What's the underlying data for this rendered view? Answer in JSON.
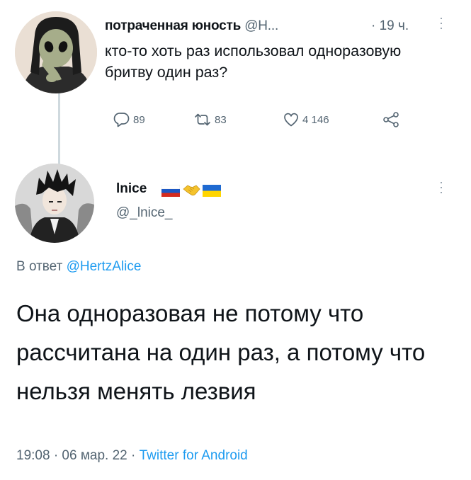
{
  "replied_tweet": {
    "display_name": "потраченная юность",
    "handle": "@Н...",
    "time": "· 19 ч.",
    "text": "кто-то хоть раз использовал одноразовую бритву один раз?",
    "replies": "89",
    "retweets": "83",
    "likes": "4 146"
  },
  "main_tweet": {
    "display_name": "lnice",
    "handle": "@_lnice_",
    "reply_prefix": "В ответ ",
    "reply_mention": "@HertzAlice",
    "text": "Она одноразовая не потому что рассчитана на один раз, а потому что нельзя менять лезвия",
    "timestamp": "19:08 · 06 мар. 22 · ",
    "client": "Twitter for Android"
  },
  "colors": {
    "text": "#0f1419",
    "secondary": "#536471",
    "link": "#1d9bf0",
    "thread_line": "#cfd9de"
  }
}
